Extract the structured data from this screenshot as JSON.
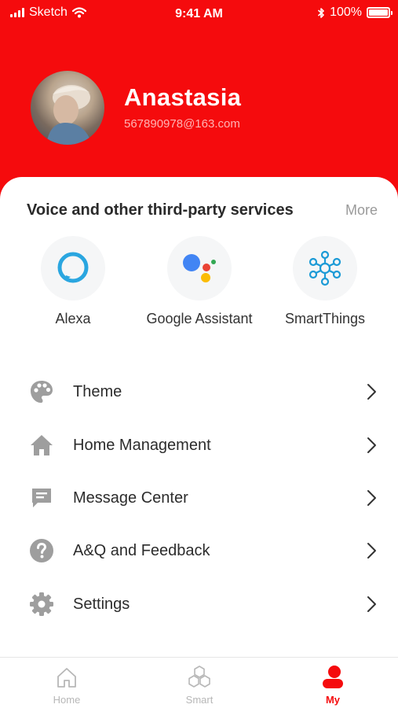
{
  "status_bar": {
    "carrier": "Sketch",
    "time": "9:41 AM",
    "battery": "100%"
  },
  "profile": {
    "name": "Anastasia",
    "email": "567890978@163.com"
  },
  "services": {
    "title": "Voice and other third-party services",
    "more_label": "More",
    "items": [
      {
        "label": "Alexa",
        "icon": "alexa-icon"
      },
      {
        "label": "Google Assistant",
        "icon": "google-assistant-icon"
      },
      {
        "label": "SmartThings",
        "icon": "smartthings-icon"
      }
    ]
  },
  "menu": {
    "items": [
      {
        "label": "Theme",
        "icon": "palette-icon"
      },
      {
        "label": "Home Management",
        "icon": "home-icon"
      },
      {
        "label": "Message Center",
        "icon": "message-icon"
      },
      {
        "label": "A&Q and Feedback",
        "icon": "help-icon"
      },
      {
        "label": "Settings",
        "icon": "gear-icon"
      }
    ]
  },
  "tabbar": {
    "items": [
      {
        "label": "Home",
        "icon": "home-outline-icon",
        "active": false
      },
      {
        "label": "Smart",
        "icon": "hexagons-icon",
        "active": false
      },
      {
        "label": "My",
        "icon": "user-icon",
        "active": true
      }
    ]
  },
  "colors": {
    "brand": "#f50b0d",
    "icon_gray": "#9e9e9e",
    "alexa_blue": "#2aa6e0",
    "smartthings_blue": "#1b9ad6",
    "google_blue": "#4285f4",
    "google_red": "#ea4335",
    "google_yellow": "#fbbc05",
    "google_green": "#34a853"
  }
}
